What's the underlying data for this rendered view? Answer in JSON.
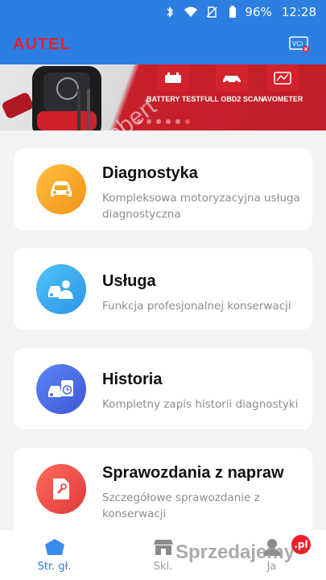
{
  "status_bar": {
    "battery": "96%",
    "time": "12:28"
  },
  "app_bar": {
    "logo": "AUTEL",
    "vci_label": "VCI"
  },
  "banner": {
    "features": [
      "BATTERY TEST",
      "FULL OBD2 SCAN",
      "AVOMETER"
    ],
    "watermark": "Robert"
  },
  "cards": [
    {
      "title": "Diagnostyka",
      "subtitle": "Kompleksowa motoryzacyjna usługa diagnostyczna",
      "color": "#f6a623"
    },
    {
      "title": "Usługa",
      "subtitle": "Funkcja profesjonalnej konserwacji",
      "color": "#3ba6ee"
    },
    {
      "title": "Historia",
      "subtitle": "Kompletny zapis historii diagnostyki",
      "color": "#4d6fe8"
    },
    {
      "title": "Sprawozdania z napraw",
      "subtitle": "Szczegółowe sprawozdanie z konserwacji",
      "color": "#ef4d4d"
    }
  ],
  "bottom_nav": {
    "items": [
      {
        "label": "Str. gł.",
        "icon": "home-icon",
        "active": true
      },
      {
        "label": "Skl.",
        "icon": "store-icon",
        "active": false
      },
      {
        "label": "Ja",
        "icon": "profile-icon",
        "active": false
      }
    ]
  },
  "watermark": {
    "text": "Sprzedajemy",
    "badge": ".pl"
  },
  "colors": {
    "primary": "#2c7fe0",
    "brand_red": "#e8212b"
  }
}
